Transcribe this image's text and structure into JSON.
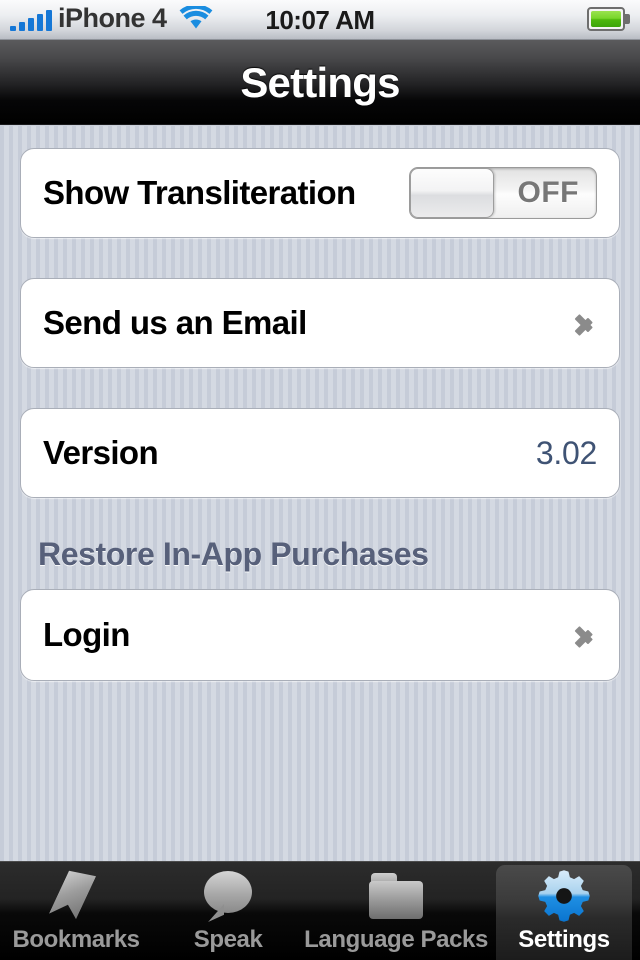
{
  "status_bar": {
    "carrier": "iPhone 4",
    "time": "10:07 AM",
    "signal_icon": "signal-bars-icon",
    "wifi_icon": "wifi-icon",
    "battery_icon": "battery-full-icon",
    "signal_bars": 5,
    "signal_color": "#1577d6",
    "battery_color": "#79d62c"
  },
  "nav_bar": {
    "title": "Settings"
  },
  "main": {
    "rows": [
      {
        "label": "Show Transliteration",
        "control": "toggle",
        "toggle_state": "OFF"
      },
      {
        "label": "Send us an Email",
        "control": "disclosure"
      },
      {
        "label": "Version",
        "control": "value",
        "value": "3.02"
      }
    ],
    "section_header": "Restore In-App Purchases",
    "login_row": {
      "label": "Login",
      "control": "disclosure"
    }
  },
  "tab_bar": {
    "tabs": [
      {
        "label": "Bookmarks",
        "icon": "bookmark-icon",
        "active": false
      },
      {
        "label": "Speak",
        "icon": "speech-bubble-icon",
        "active": false
      },
      {
        "label": "Language Packs",
        "icon": "folder-icon",
        "active": false
      },
      {
        "label": "Settings",
        "icon": "gear-icon",
        "active": true
      }
    ]
  },
  "colors": {
    "accent_blue": "#1577d6",
    "value_text": "#3f5374",
    "section_header_text": "#57607a",
    "active_tab_label": "#ffffff",
    "inactive_tab_label": "#9a9a9a",
    "gear_blue_light": "#bfe0f5",
    "gear_blue_dark": "#0b82e0"
  }
}
